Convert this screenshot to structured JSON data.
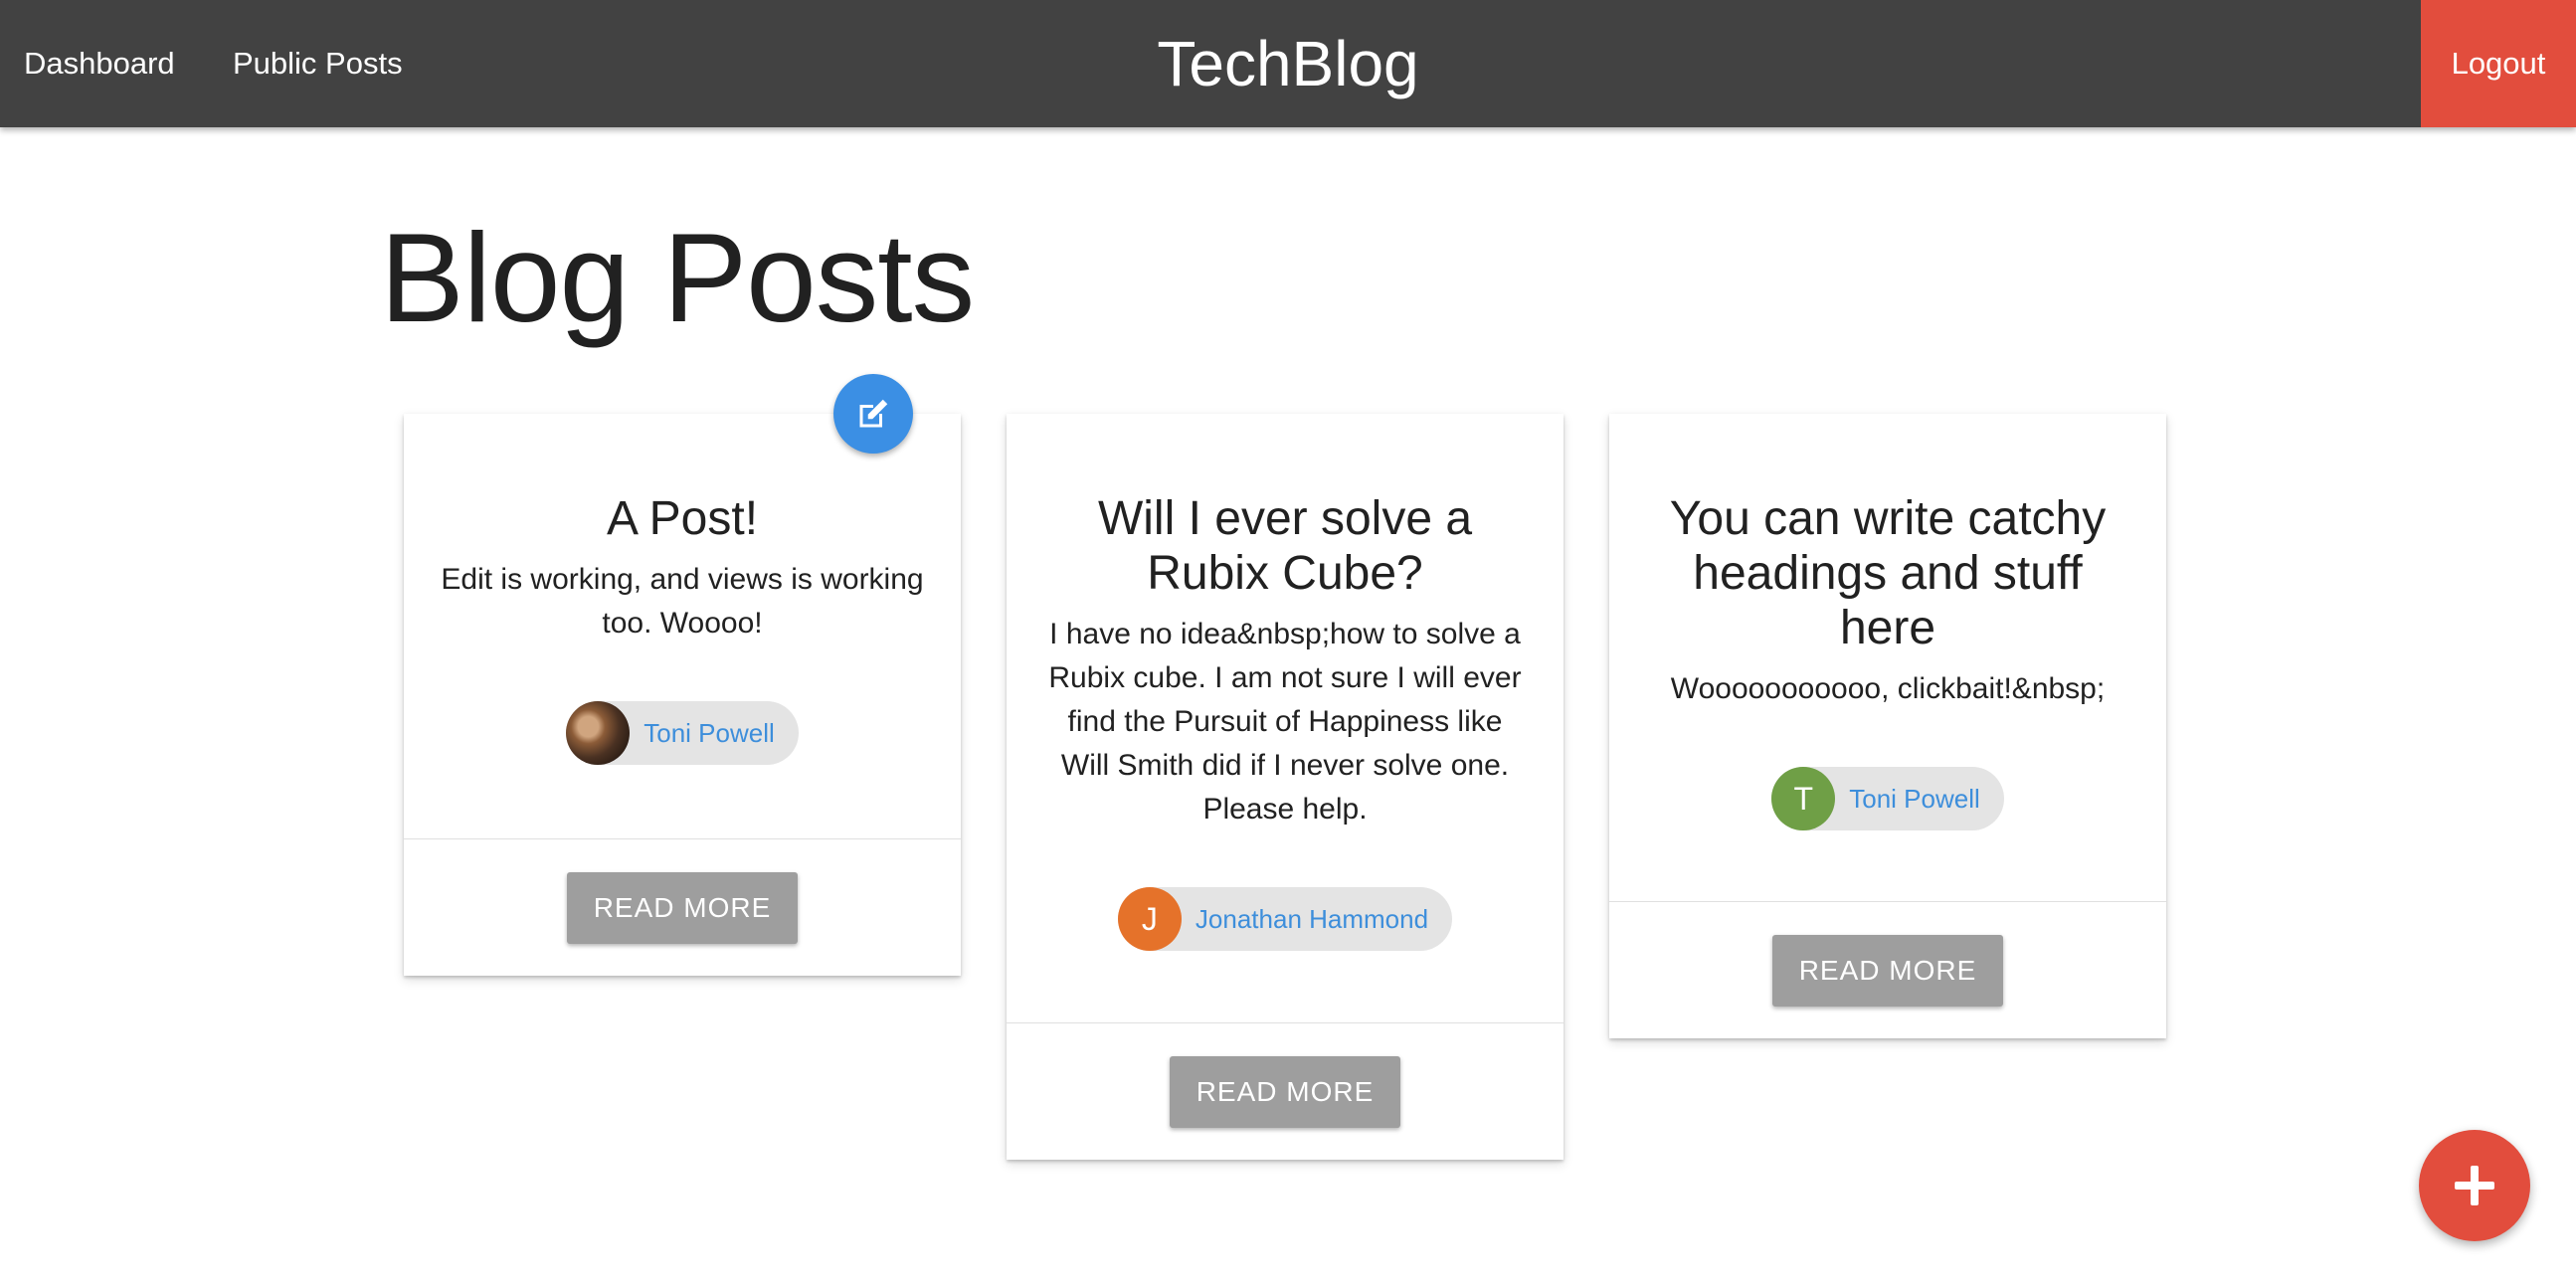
{
  "nav": {
    "links": [
      {
        "label": "Dashboard"
      },
      {
        "label": "Public Posts"
      }
    ],
    "brand": "TechBlog",
    "logout_label": "Logout"
  },
  "page": {
    "title": "Blog Posts"
  },
  "posts": [
    {
      "title": "A Post!",
      "body": "Edit is working, and views is working too. Woooo!",
      "author": "Toni Powell",
      "avatar_initial": "",
      "avatar_type": "photo",
      "read_more_label": "READ MORE"
    },
    {
      "title": "Will I ever solve a Rubix Cube?",
      "body": "I have no idea&nbsp;how to solve a Rubix cube. I am not sure I will ever find the Pursuit of Happiness like Will Smith did if I never solve one. Please help.",
      "author": "Jonathan Hammond",
      "avatar_initial": "J",
      "avatar_color": "#e5722a",
      "read_more_label": "READ MORE"
    },
    {
      "title": "You can write catchy headings and stuff here",
      "body": "Wooooooooooo, clickbait!&nbsp;",
      "author": "Toni Powell",
      "avatar_initial": "T",
      "avatar_color": "#6f9f46",
      "read_more_label": "READ MORE"
    }
  ],
  "actions": {
    "edit_icon": "edit-icon",
    "add_icon": "plus-icon"
  },
  "colors": {
    "navbar": "#424242",
    "logout": "#e24d3d",
    "edit_fab": "#3b8fe4",
    "add_fab": "#e24d3d",
    "author_link": "#3d8edb",
    "read_more_button": "#9e9e9e"
  }
}
